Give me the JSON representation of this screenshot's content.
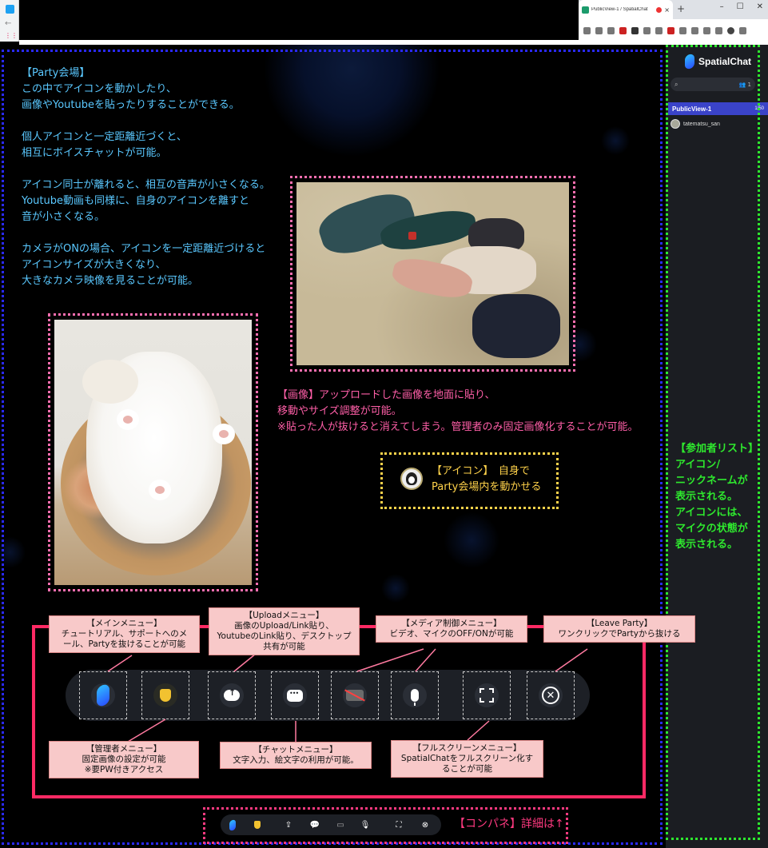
{
  "browser": {
    "tab_title": "PublicView-1 / SpatialChat",
    "tab_close": "×",
    "new_tab": "+",
    "window_buttons": [
      "–",
      "☐",
      "✕"
    ],
    "back": "←",
    "apps": "⋮⋮⋮"
  },
  "app": {
    "logo_text": "SpatialChat",
    "search_icon": "search-icon",
    "participants_count": "1",
    "room": {
      "name": "PublicView-1",
      "capacity": "1/50"
    },
    "participants": [
      {
        "name": "tatematsu_san"
      }
    ]
  },
  "annotations": {
    "party_hall": "【Party会場】\nこの中でアイコンを動かしたり、\n画像やYoutubeを貼ったりすることができる。\n\n個人アイコンと一定距離近づくと、\n相互にボイスチャットが可能。\n\nアイコン同士が離れると、相互の音声が小さくなる。\nYoutube動画も同様に、自身のアイコンを離すと\n音が小さくなる。\n\nカメラがONの場合、アイコンを一定距離近づけると\nアイコンサイズが大きくなり、\n大きなカメラ映像を見ることが可能。",
    "image_note": "【画像】アップロードした画像を地面に貼り、\n移動やサイズ調整が可能。\n※貼った人が抜けると消えてしまう。管理者のみ固定画像化することが可能。",
    "icon_note": "【アイコン】　自身で\nParty会場内を動かせる",
    "participant_list_note": "【参加者リスト】\nアイコン/\nニックネームが\n表示される。\nアイコンには、\nマイクの状態が\n表示される。",
    "control_panel_note": "【コンパネ】詳細は↑"
  },
  "callouts": {
    "main_menu": "【メインメニュー】\nチュートリアル、サポートへのメ\nール、Partyを抜けることが可能",
    "upload_menu": "【Uploadメニュー】\n画像のUpload/Link貼り、\nYoutubeのLink貼り、デスクトップ\n共有が可能",
    "media_menu": "【メディア制御メニュー】\nビデオ、マイクのOFF/ONが可能",
    "leave_party": "【Leave Party】\nワンクリックでPartyから抜ける",
    "admin_menu": "【管理者メニュー】\n固定画像の設定が可能\n※要PW付きアクセス",
    "chat_menu": "【チャットメニュー】\n文字入力、絵文字の利用が可能。",
    "fullscreen_menu": "【フルスクリーンメニュー】\nSpatialChatをフルスクリーン化す\nることが可能"
  },
  "control_panel": {
    "buttons": [
      {
        "icon": "spatialchat-logo-icon"
      },
      {
        "icon": "admin-shield-icon"
      },
      {
        "icon": "upload-icon"
      },
      {
        "icon": "chat-icon"
      },
      {
        "icon": "camera-off-icon"
      },
      {
        "icon": "microphone-icon"
      },
      {
        "icon": "fullscreen-icon"
      },
      {
        "icon": "leave-icon",
        "glyph": "✕"
      }
    ]
  },
  "colors": {
    "blue_frame": "#2a2aff",
    "green_frame": "#2ee82e",
    "pink_frame": "#ff6fb0",
    "yellow_frame": "#ffd24a",
    "red_frame": "#ff2a64",
    "room_highlight": "#3a43c9",
    "callout_bg": "#f8c9c9"
  }
}
